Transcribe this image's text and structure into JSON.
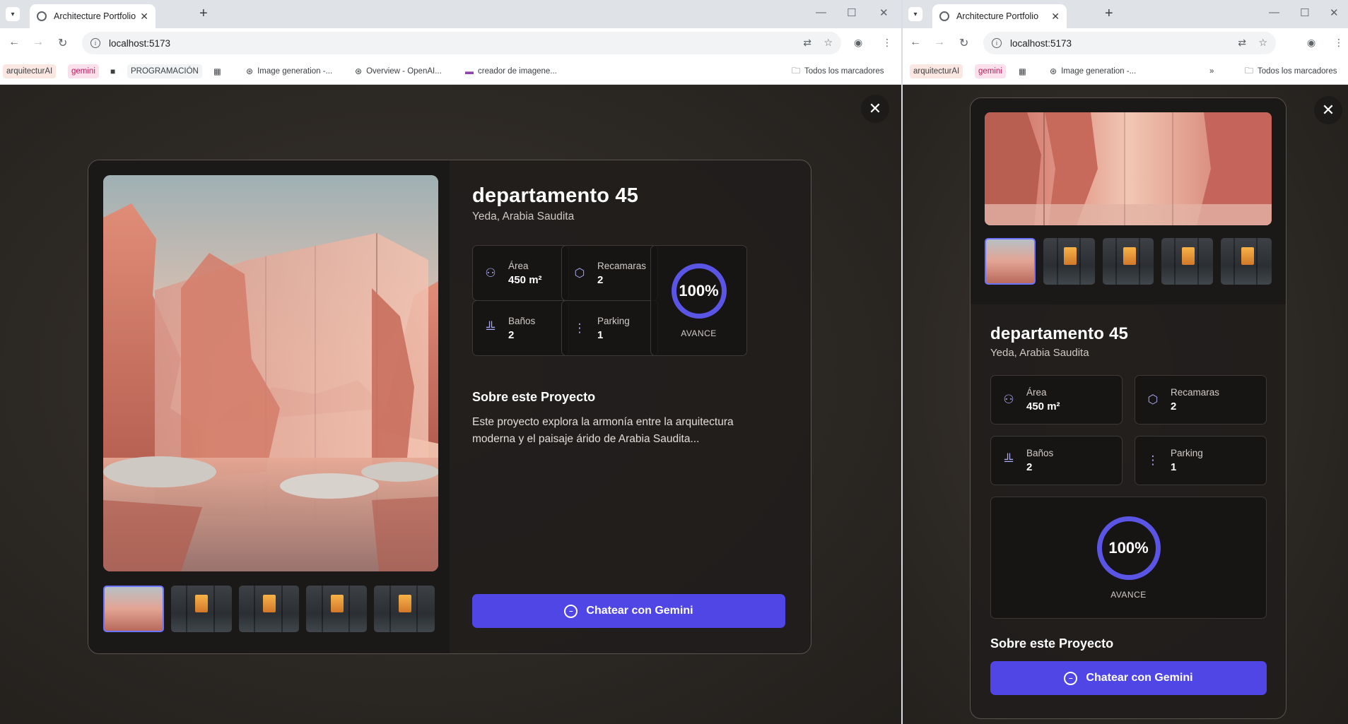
{
  "browser": {
    "tab_title": "Architecture Portfolio",
    "url": "localhost:5173",
    "bookmarks_left": [
      "arquitecturAI",
      "gemini",
      "PROGRAMACIÓN",
      "Image generation -...",
      "Overview - OpenAI...",
      "creador de imagene..."
    ],
    "bookmarks_right": [
      "arquitecturAI",
      "gemini",
      "Image generation -..."
    ],
    "all_bookmarks": "Todos los marcadores"
  },
  "project": {
    "title": "departamento 45",
    "location": "Yeda, Arabia Saudita",
    "stats": {
      "area_label": "Área",
      "area_value": "450 m²",
      "rooms_label": "Recamaras",
      "rooms_value": "2",
      "baths_label": "Baños",
      "baths_value": "2",
      "parking_label": "Parking",
      "parking_value": "1"
    },
    "progress_value": "100%",
    "progress_fraction": 1.0,
    "progress_label": "AVANCE",
    "about_heading": "Sobre este Proyecto",
    "about_text": "Este proyecto explora la armonía entre la arquitectura moderna y el paisaje árido de Arabia Saudita...",
    "cta_label": "Chatear con Gemini"
  },
  "icons": {
    "area": "user-plus-icon",
    "rooms": "cube-icon",
    "baths": "chart-icon",
    "parking": "dots-vertical-icon",
    "close": "close-icon",
    "chat": "chat-icon"
  },
  "colors": {
    "accent": "#5046e5",
    "ring": "#5b55e6",
    "icon_tint": "#a9adf5"
  }
}
